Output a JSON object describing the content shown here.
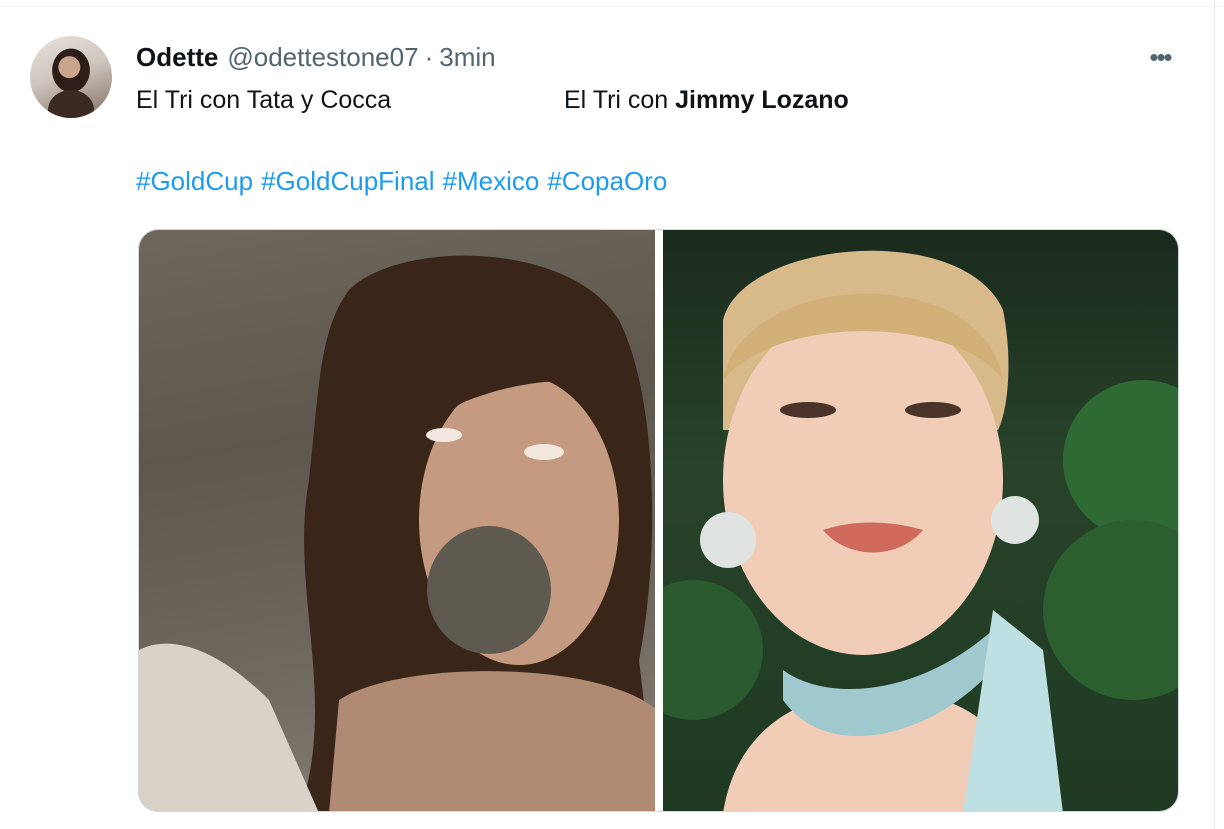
{
  "tweet": {
    "author": {
      "name": "Odette",
      "handle": "@odettestone07",
      "separator": "·",
      "time": "3min"
    },
    "more_icon": "more-horizontal-icon",
    "text": {
      "left": "El Tri con Tata y Cocca",
      "right_prefix": "El Tri con ",
      "right_bold": "Jimmy Lozano"
    },
    "hashtags": [
      "#GoldCup",
      "#GoldCupFinal",
      "#Mexico",
      "#CopaOro"
    ],
    "media": {
      "count": 2
    }
  },
  "colors": {
    "link": "#1d9bf0",
    "secondary_text": "#536471",
    "primary_text": "#0f1419",
    "border": "#cfd9de"
  }
}
